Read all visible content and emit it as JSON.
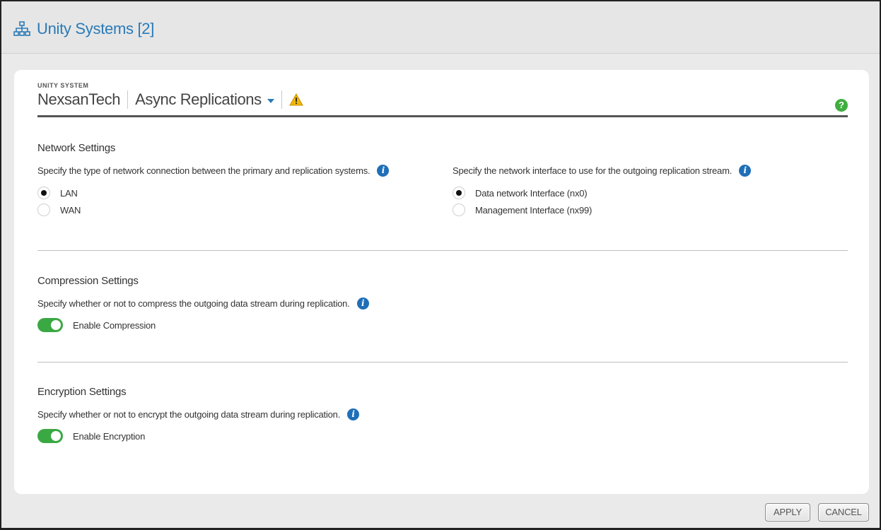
{
  "header": {
    "title": "Unity Systems [2]",
    "icon": "network-icon"
  },
  "card": {
    "eyebrow": "UNITY SYSTEM",
    "system_name": "NexsanTech",
    "view": "Async Replications",
    "warning_icon": "warning-icon",
    "help_icon": "?"
  },
  "network": {
    "title": "Network Settings",
    "left_desc": "Specify the type of network connection between the primary and replication systems.",
    "left_options": [
      {
        "label": "LAN",
        "checked": true
      },
      {
        "label": "WAN",
        "checked": false
      }
    ],
    "right_desc": "Specify the network interface to use for the outgoing replication stream.",
    "right_options": [
      {
        "label": "Data network Interface (nx0)",
        "checked": true
      },
      {
        "label": "Management Interface (nx99)",
        "checked": false
      }
    ]
  },
  "compression": {
    "title": "Compression Settings",
    "desc": "Specify whether or not to compress the outgoing data stream during replication.",
    "toggle_label": "Enable Compression",
    "enabled": true
  },
  "encryption": {
    "title": "Encryption Settings",
    "desc": "Specify whether or not to encrypt the outgoing data stream during replication.",
    "toggle_label": "Enable Encryption",
    "enabled": true
  },
  "footer": {
    "apply_label": "APPLY",
    "cancel_label": "CANCEL"
  },
  "info_glyph": "i",
  "colors": {
    "accent_blue": "#2a7ab8",
    "info_blue": "#1f6fb8",
    "toggle_green": "#3aa843",
    "help_green": "#3fae3f",
    "warning_yellow": "#f2b705"
  }
}
